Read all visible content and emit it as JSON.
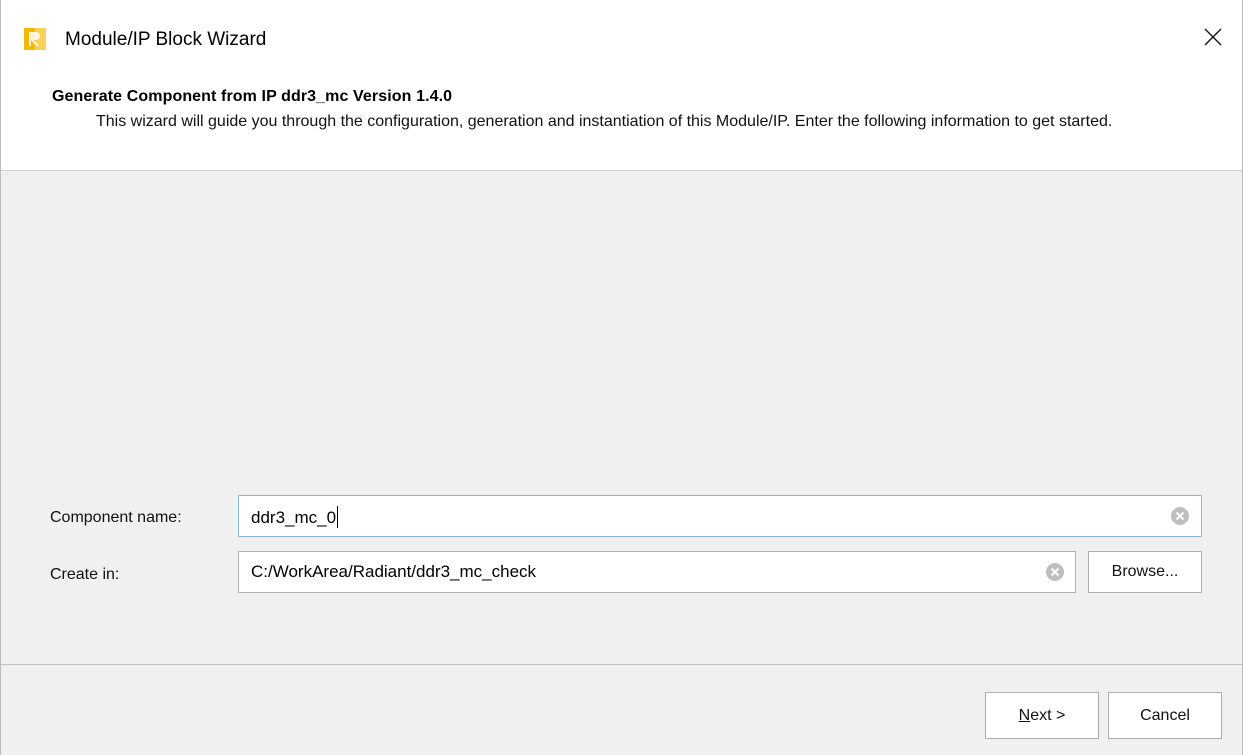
{
  "window": {
    "title": "Module/IP Block Wizard",
    "close_glyph": "✕"
  },
  "header": {
    "title": "Generate Component from IP ddr3_mc Version 1.4.0",
    "description": "This wizard will guide you through the configuration, generation and instantiation of this Module/IP. Enter the following information to get started."
  },
  "form": {
    "component_name_label": "Component name:",
    "component_name_value": "ddr3_mc_0",
    "create_in_label": "Create in:",
    "create_in_value": "C:/WorkArea/Radiant/ddr3_mc_check",
    "browse_label": "Browse..."
  },
  "footer": {
    "next_mnemonic": "N",
    "next_rest": "ext >",
    "cancel_label": "Cancel"
  },
  "icons": {
    "app": "radiant-app-icon",
    "close": "close-icon",
    "clear": "clear-circle-icon"
  },
  "colors": {
    "app_icon_yellow": "#f5b800",
    "app_icon_orange": "#f7d15a",
    "focus_border": "#8cb3d8"
  }
}
